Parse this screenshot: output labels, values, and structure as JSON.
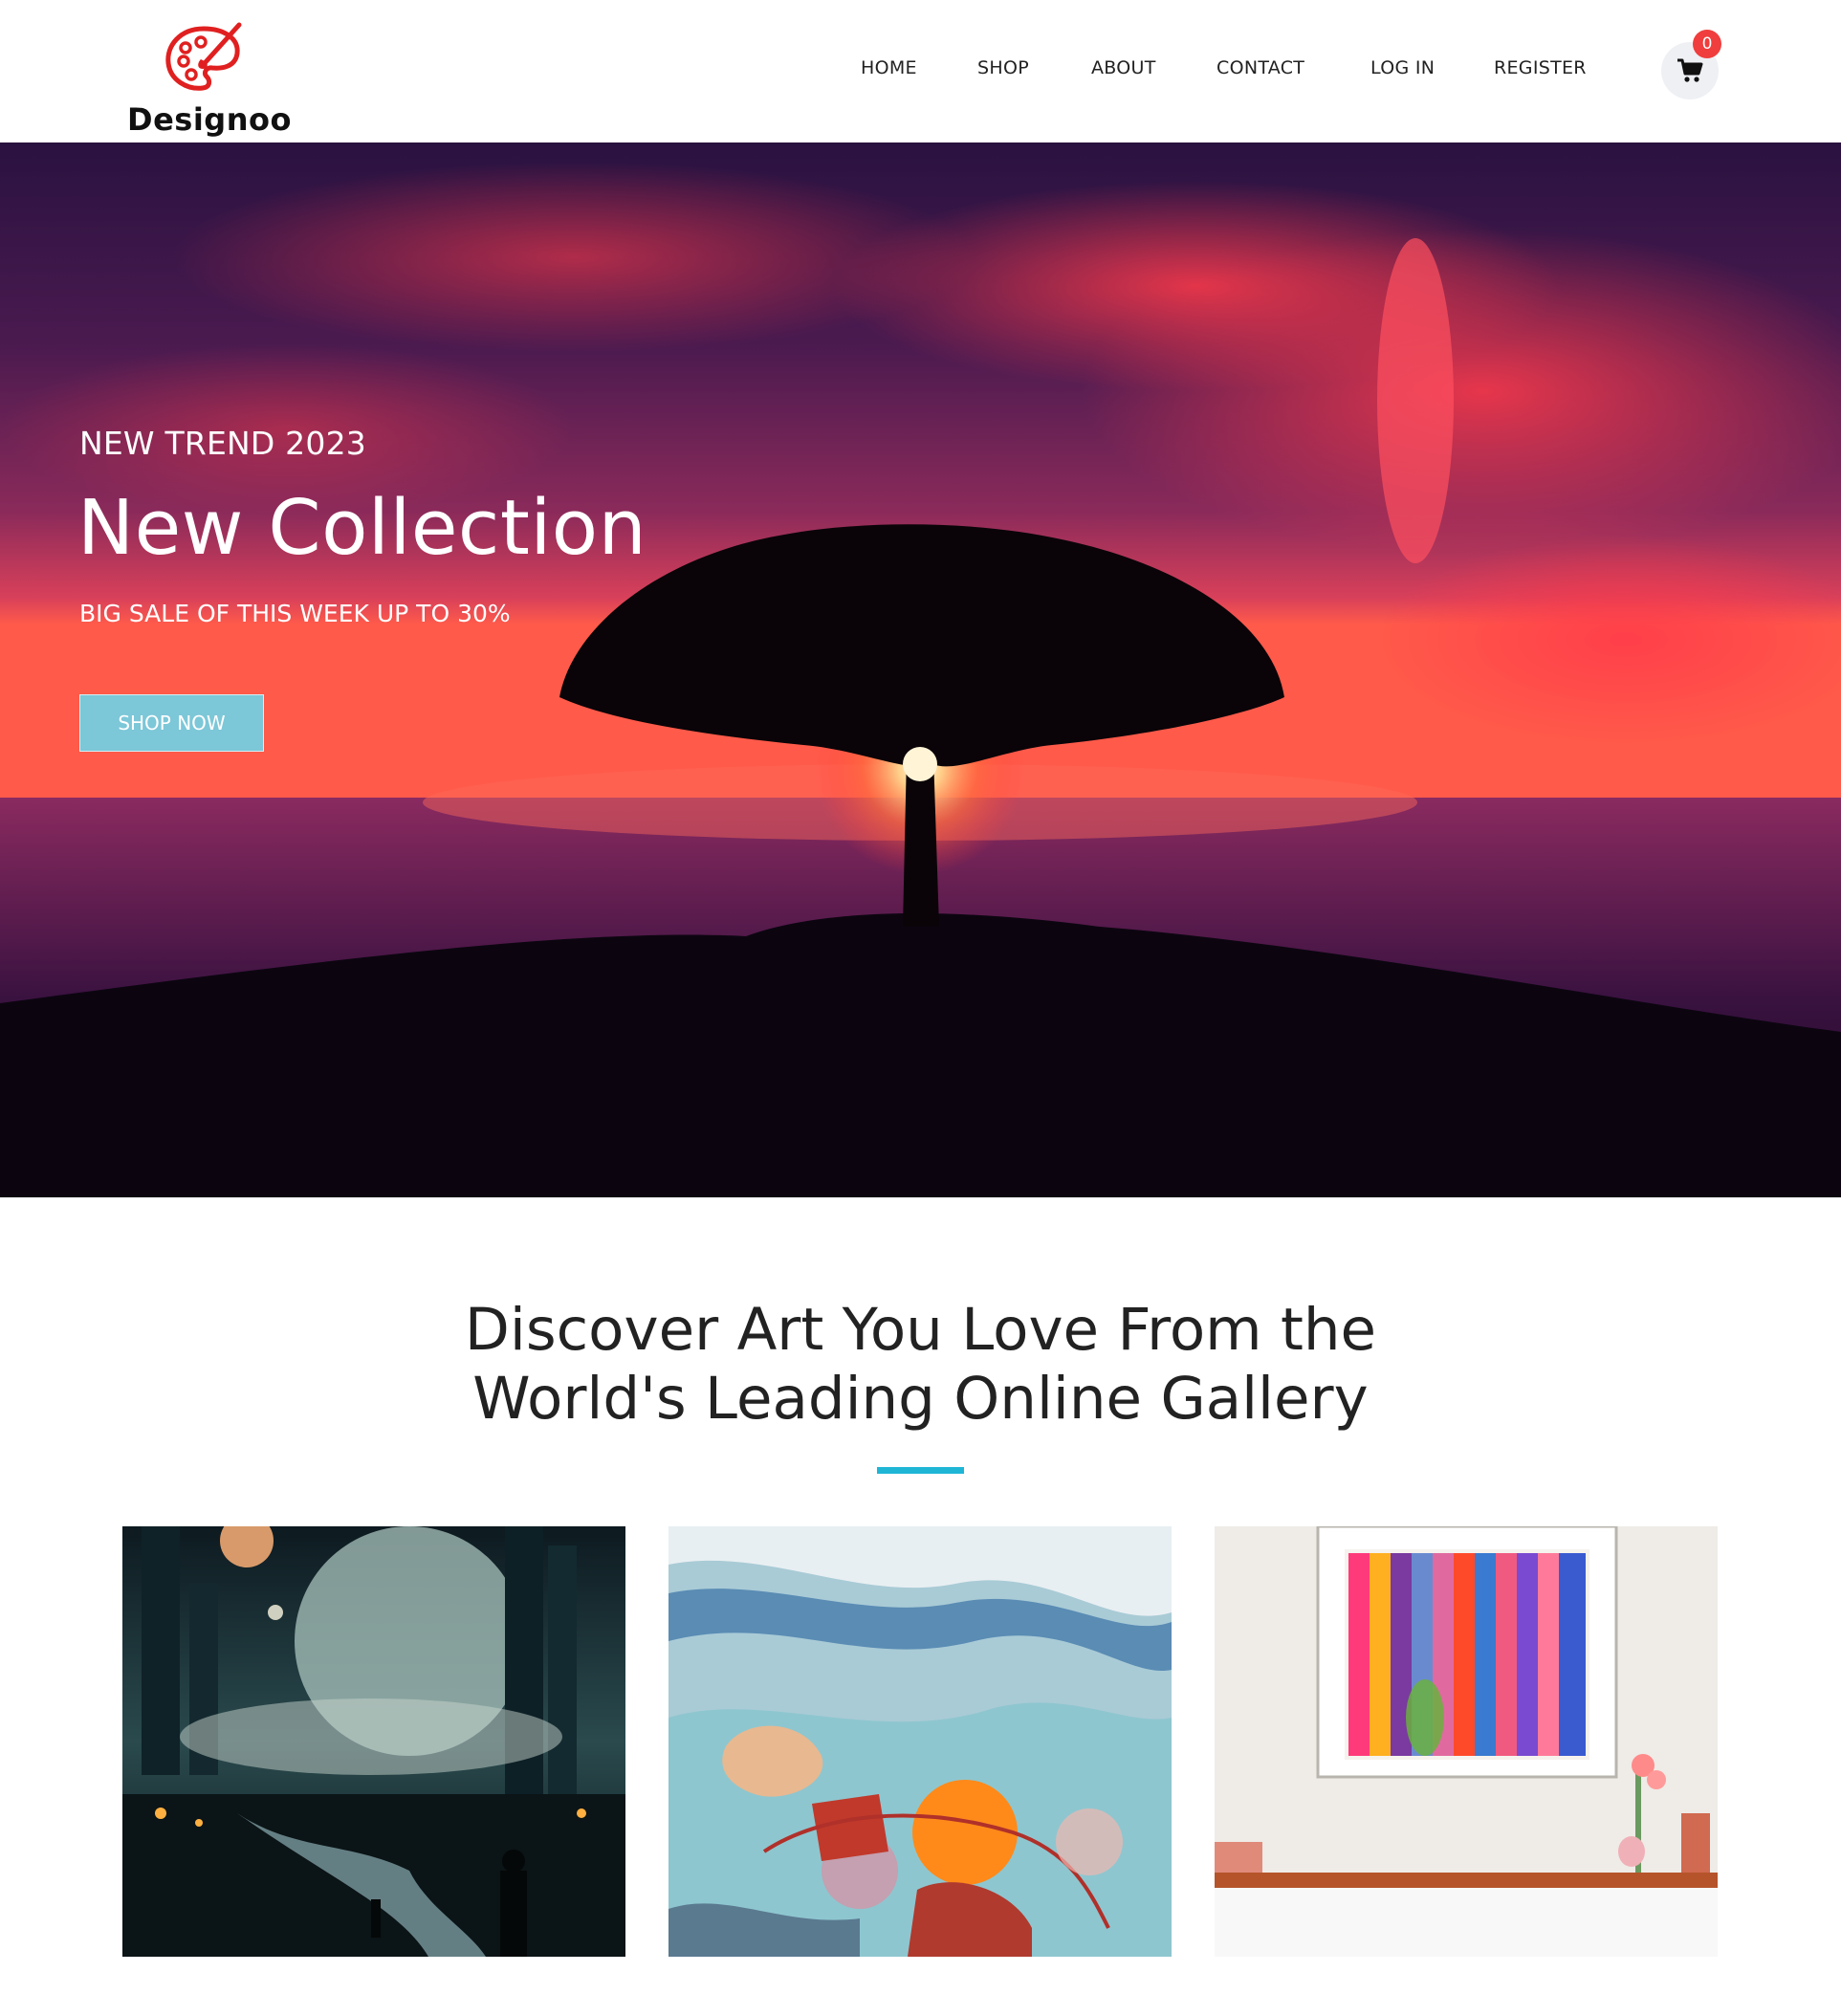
{
  "brand": {
    "name": "Designoo",
    "logo_icon": "palette-icon",
    "logo_color": "#e02020"
  },
  "nav": {
    "items": [
      {
        "label": "HOME"
      },
      {
        "label": "SHOP"
      },
      {
        "label": "ABOUT"
      },
      {
        "label": "CONTACT"
      },
      {
        "label": "LOG IN"
      },
      {
        "label": "REGISTER"
      }
    ]
  },
  "cart": {
    "icon": "shopping-cart-icon",
    "count": "0",
    "badge_color": "#f03d3d"
  },
  "hero": {
    "kicker": "NEW TREND 2023",
    "title": "New Collection",
    "subtitle": "BIG SALE OF THIS WEEK UP TO 30%",
    "cta_label": "SHOP NOW",
    "cta_color": "#7cc7d8"
  },
  "discover": {
    "title_line1": "Discover Art You Love From the",
    "title_line2": "World's Leading Online Gallery",
    "accent_color": "#1fb6d6"
  },
  "gallery": {
    "cards": [
      {
        "image": "futuristic-city-artwork"
      },
      {
        "image": "abstract-coastal-artwork"
      },
      {
        "image": "framed-colorful-print-artwork"
      }
    ]
  }
}
